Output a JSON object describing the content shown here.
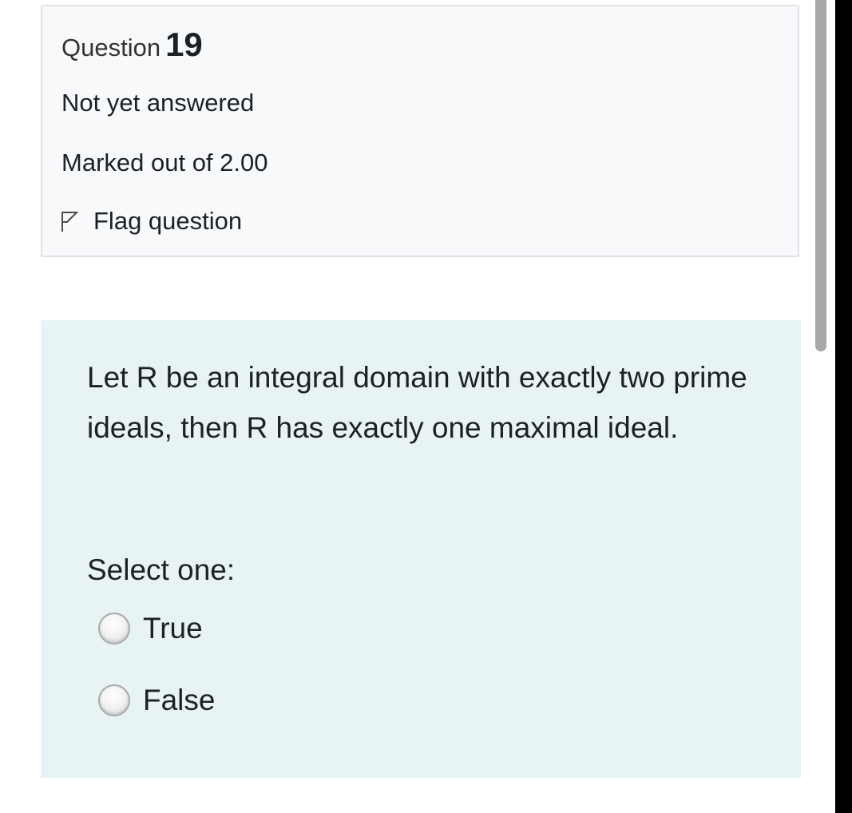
{
  "question": {
    "label": "Question",
    "number": "19",
    "state": "Not yet answered",
    "grade": "Marked out of 2.00",
    "flag_label": "Flag question",
    "flag_icon": "flag-outline-icon"
  },
  "content": {
    "text": "Let R be an integral domain with exactly two prime ideals, then R has exactly one maximal ideal.",
    "prompt": "Select one:",
    "options": [
      {
        "label": "True",
        "selected": false
      },
      {
        "label": "False",
        "selected": false
      }
    ]
  },
  "colors": {
    "info_background": "#f8f9fa",
    "content_background": "#e7f3f5",
    "text": "#1d2125"
  }
}
